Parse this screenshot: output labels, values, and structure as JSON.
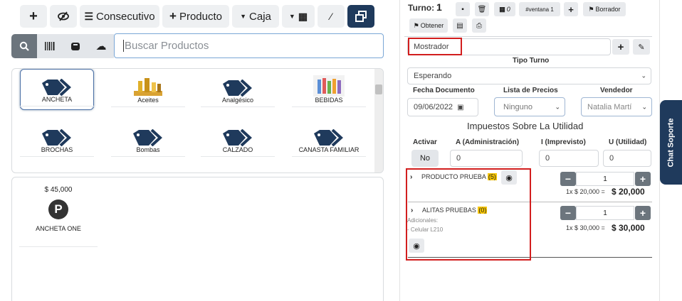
{
  "toolbar": {
    "consecutivo_label": "Consecutivo",
    "producto_label": "Producto",
    "caja_label": "Caja"
  },
  "search": {
    "placeholder": "Buscar Productos"
  },
  "categories": [
    {
      "label": "ANCHETA"
    },
    {
      "label": "Aceites"
    },
    {
      "label": "Analgésico"
    },
    {
      "label": "BEBIDAS"
    },
    {
      "label": "BROCHAS"
    },
    {
      "label": "Bombas"
    },
    {
      "label": "CALZADO"
    },
    {
      "label": "CANASTA FAMILIAR"
    }
  ],
  "products": [
    {
      "price": "$ 45,000",
      "name": "ANCHETA ONE",
      "avatar_letter": "P"
    }
  ],
  "turno": {
    "label": "Turno:",
    "number": "1",
    "count": "0",
    "ventana_tag": "#ventana 1",
    "borrador_label": "Borrador",
    "obtener_label": "Obtener"
  },
  "order": {
    "customer": "Mostrador",
    "tipo_turno_label": "Tipo Turno",
    "tipo_turno_value": "Esperando",
    "fecha_label": "Fecha Documento",
    "fecha_value": "09/06/2022",
    "lista_label": "Lista de Precios",
    "lista_value": "Ninguno",
    "vendedor_label": "Vendedor",
    "vendedor_value": "Natalia Martí",
    "impuestos_title": "Impuestos Sobre La Utilidad",
    "activar_label": "Activar",
    "activar_value": "No",
    "admin_label": "A (Administración)",
    "admin_value": "0",
    "imprevisto_label": "I (Imprevisto)",
    "imprevisto_value": "0",
    "utilidad_label": "U (Utilidad)",
    "utilidad_value": "0"
  },
  "cart": [
    {
      "name": "PRODUCTO PRUEBA",
      "badge": "(5)",
      "qty": "1",
      "unit_line": "1x $ 20,000 =",
      "total": "$ 20,000"
    },
    {
      "name": "ALITAS PRUEBAS",
      "badge": "(0)",
      "qty": "1",
      "unit_line": "1x $ 30,000 =",
      "total": "$ 30,000",
      "adicionales_label": "Adicionales:",
      "adicional_item": "- Celular L210"
    }
  ],
  "chat": {
    "label": "Chat Soporte"
  },
  "colors": {
    "accent": "#1f3a5c",
    "highlight": "#d21e1e",
    "badge": "#f7c600"
  }
}
